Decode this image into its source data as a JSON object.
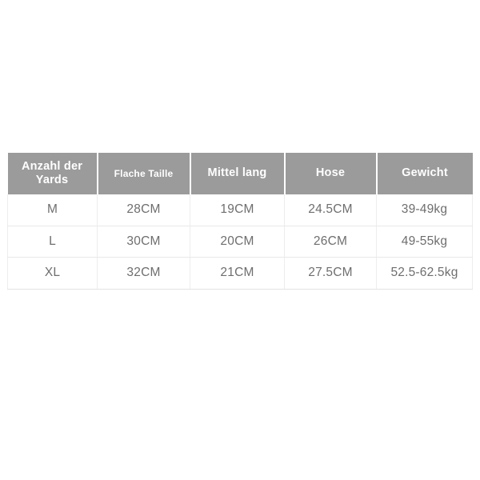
{
  "table": {
    "headers": [
      {
        "label": "Anzahl der Yards",
        "size": "large"
      },
      {
        "label": "Flache Taille",
        "size": "small"
      },
      {
        "label": "Mittel lang",
        "size": "large"
      },
      {
        "label": "Hose",
        "size": "large"
      },
      {
        "label": "Gewicht",
        "size": "large"
      }
    ],
    "rows": [
      {
        "size": "M",
        "flat_waist": "28CM",
        "middle_length": "19CM",
        "pants": "24.5CM",
        "weight": "39-49kg"
      },
      {
        "size": "L",
        "flat_waist": "30CM",
        "middle_length": "20CM",
        "pants": "26CM",
        "weight": "49-55kg"
      },
      {
        "size": "XL",
        "flat_waist": "32CM",
        "middle_length": "21CM",
        "pants": "27.5CM",
        "weight": "52.5-62.5kg"
      }
    ],
    "colors": {
      "header_background": "#9b9b9b",
      "header_text": "#ffffff",
      "body_text": "#6e6e6e",
      "weight_text": "#1a1a1a",
      "border": "#ededed",
      "page_background": "#ffffff"
    }
  }
}
